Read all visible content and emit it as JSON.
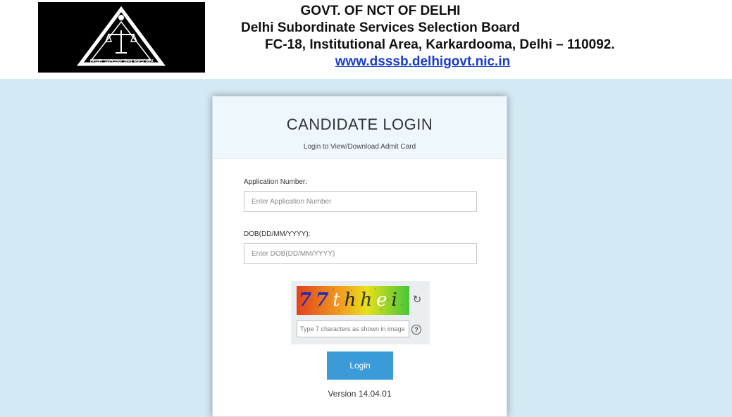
{
  "header": {
    "logo": {
      "arc_text": "दिल्ली अधीनस्थ सेवा चयन बोर्ड",
      "motto": "दिल्ली अधीनस्थ सेवा चयन बोर्ड"
    },
    "org_line1": "GOVT. OF NCT OF DELHI",
    "org_line2": "Delhi Subordinate Services Selection Board",
    "org_line3": "FC-18, Institutional Area, Karkardooma, Delhi – 110092.",
    "website": "www.dsssb.delhigovt.nic.in"
  },
  "login": {
    "title": "CANDIDATE LOGIN",
    "subtitle": "Login to View/Download Admit Card",
    "app_number_label": "Application Number:",
    "app_number_placeholder": "Enter Application Number",
    "app_number_value": "",
    "dob_label": "DOB(DD/MM/YYYY):",
    "dob_placeholder": "Enter DOB(DD/MM/YYYY)",
    "dob_value": "",
    "captcha": {
      "text": "77thhei",
      "input_placeholder": "Type 7 characters as shown in image",
      "refresh_icon": "refresh-icon",
      "help_icon": "help-icon",
      "help_glyph": "?"
    },
    "login_label": "Login",
    "version": "Version 14.04.01"
  },
  "colors": {
    "page_bg": "#d3e9f3",
    "card_head_bg": "#eef8fc",
    "login_button": "#3a9bd8",
    "link": "#1a3ccc"
  }
}
